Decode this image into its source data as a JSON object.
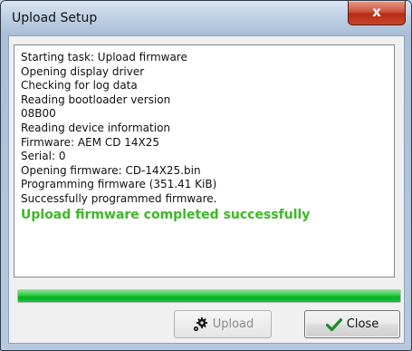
{
  "window": {
    "title": "Upload Setup",
    "close_glyph": "x"
  },
  "log": {
    "lines": [
      "Starting task: Upload firmware",
      "Opening display driver",
      "Checking for log data",
      "Reading bootloader version",
      "08B00",
      "Reading device information",
      "Firmware: AEM CD  14X25",
      "Serial: 0",
      "Opening firmware: CD-14X25.bin",
      "Programming firmware (351.41 KiB)",
      "Successfully programmed firmware."
    ],
    "success_message": "Upload firmware completed successfully",
    "success_color": "#3cb826"
  },
  "progress": {
    "fraction": 1.0,
    "color": "#06b025"
  },
  "buttons": {
    "upload": {
      "label": "Upload",
      "icon": "gear-icon",
      "enabled": false
    },
    "close": {
      "label": "Close",
      "icon": "check-icon",
      "enabled": true
    }
  }
}
